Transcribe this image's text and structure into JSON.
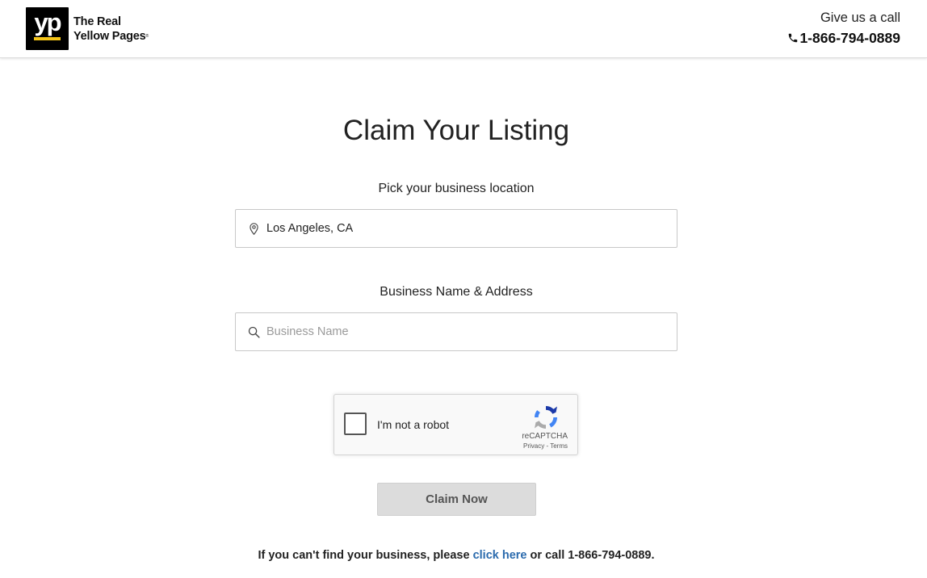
{
  "header": {
    "logo_letters": "yp",
    "brand_line1": "The Real",
    "brand_line2": "Yellow Pages",
    "call_label": "Give us a call",
    "call_phone": "1-866-794-0889"
  },
  "main": {
    "title": "Claim Your Listing",
    "location": {
      "label": "Pick your business location",
      "value": "Los Angeles, CA",
      "icon": "map-pin-icon"
    },
    "business": {
      "label": "Business Name & Address",
      "placeholder": "Business Name",
      "value": "",
      "icon": "search-icon"
    },
    "captcha": {
      "label": "I'm not a robot",
      "brand": "reCAPTCHA",
      "privacy": "Privacy",
      "separator": " - ",
      "terms": "Terms"
    },
    "claim_button": "Claim Now",
    "footer": {
      "prefix": "If you can't find your business, please ",
      "link": "click here",
      "suffix": " or call 1-866-794-0889."
    }
  },
  "colors": {
    "logo_bg": "#000000",
    "logo_accent": "#f5c518",
    "link": "#2a6aad",
    "button_bg": "#dcdcdc"
  }
}
